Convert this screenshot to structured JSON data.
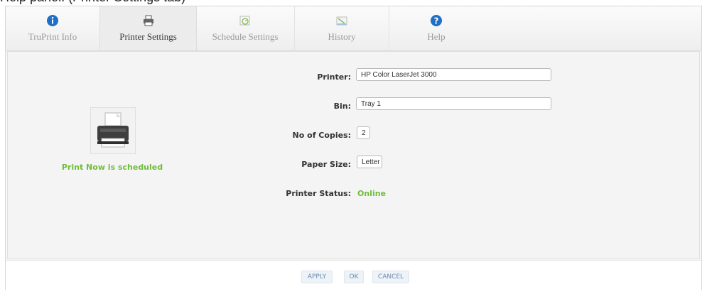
{
  "caption": "Help panel. (Printer Settings tab)",
  "tabs": [
    {
      "label": "TruPrint Info",
      "icon": "info-icon"
    },
    {
      "label": "Printer Settings",
      "icon": "printer-icon"
    },
    {
      "label": "Schedule Settings",
      "icon": "schedule-icon"
    },
    {
      "label": "History",
      "icon": "history-icon"
    },
    {
      "label": "Help",
      "icon": "help-icon"
    }
  ],
  "active_tab": "Printer Settings",
  "status_message": "Print Now is scheduled",
  "form": {
    "printer_label": "Printer:",
    "printer_value": "HP Color LaserJet 3000",
    "bin_label": "Bin:",
    "bin_value": "Tray 1",
    "copies_label": "No of Copies:",
    "copies_value": "2",
    "paper_label": "Paper Size:",
    "paper_value": "Letter",
    "status_label": "Printer Status:",
    "status_value": "Online"
  },
  "buttons": {
    "apply": "APPLY",
    "ok": "OK",
    "cancel": "CANCEL"
  },
  "colors": {
    "status_green": "#6fbd3b",
    "button_text": "#6b8bb0",
    "info_blue": "#1f6fc5"
  }
}
